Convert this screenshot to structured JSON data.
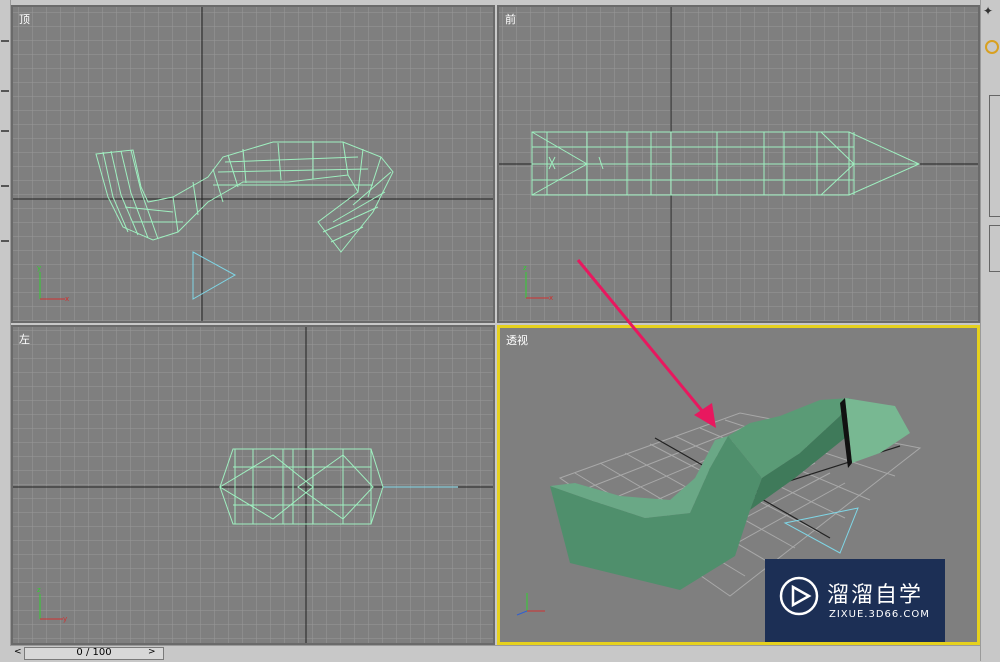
{
  "viewports": {
    "top": {
      "label": "顶"
    },
    "front": {
      "label": "前"
    },
    "left": {
      "label": "左"
    },
    "perspective": {
      "label": "透视"
    }
  },
  "timeline": {
    "frame_text": "0 / 100",
    "prev": "<",
    "next": ">"
  },
  "watermark": {
    "title": "溜溜自学",
    "subtitle": "ZIXUE.3D66.COM"
  },
  "colors": {
    "wireframe": "#9ff0c0",
    "grid_line": "#999999",
    "active_border": "#e6d11e",
    "annotation_arrow": "#e8185f",
    "mesh": "#4a8a6a"
  }
}
